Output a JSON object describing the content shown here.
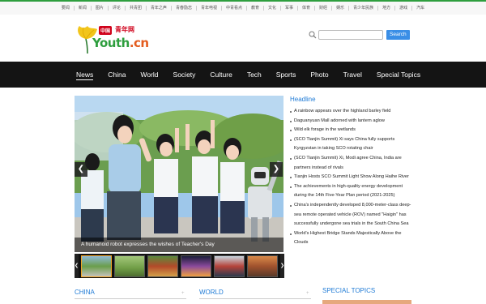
{
  "topbar": {
    "links": [
      "要闻",
      "新闻",
      "图片",
      "评论",
      "共青团",
      "青年之声",
      "青春励志",
      "青年电视",
      "中青看点",
      "教育",
      "文化",
      "军事",
      "体育",
      "财经",
      "娱乐",
      "青少年民族",
      "地方",
      "游戏",
      "汽车"
    ]
  },
  "logo": {
    "badge": "中国",
    "cn_text": "青年网",
    "en_prefix": "Y",
    "en_main": "outh",
    "en_suffix": ".cn"
  },
  "search": {
    "placeholder": "",
    "button_label": "Search"
  },
  "nav": {
    "items": [
      {
        "label": "News",
        "active": true
      },
      {
        "label": "China",
        "active": false
      },
      {
        "label": "World",
        "active": false
      },
      {
        "label": "Society",
        "active": false
      },
      {
        "label": "Culture",
        "active": false
      },
      {
        "label": "Tech",
        "active": false
      },
      {
        "label": "Sports",
        "active": false
      },
      {
        "label": "Photo",
        "active": false
      },
      {
        "label": "Travel",
        "active": false
      },
      {
        "label": "Special Topics",
        "active": false
      }
    ]
  },
  "hero": {
    "caption": "A humanoid robot expresses the wishes of Teacher's Day",
    "prev_glyph": "❮",
    "next_glyph": "❯"
  },
  "thumbs": {
    "prev_glyph": "❮",
    "next_glyph": "❯",
    "count": 6
  },
  "headline": {
    "title": "Headline",
    "items": [
      "A rainbow appears over the highland barley field",
      "Daguanyuan Mall adorned with lantern aglow",
      "Wild elk forage in the wetlands",
      "(SCO Tianjin Summit) Xi says China fully supports Kyrgyzstan in taking SCO rotating chair",
      "(SCO Tianjin Summit) Xi, Modi agree China, India are partners instead of rivals",
      "Tianjin Hosts SCO Summit Light Show Along Haihe River",
      "The achievements in high-quality energy development during the 14th Five-Year Plan period (2021-2025)",
      "China's independently developed 8,000-meter-class deep-sea remote operated vehicle (ROV) named \"Haigin\" has successfully undergone sea trials in the South China Sea",
      "World's Highest Bridge Stands Majestically Above the Clouds"
    ]
  },
  "sections": {
    "china": "CHINA",
    "world": "WORLD",
    "special": "SPECIAL TOPICS",
    "more_glyph": "+"
  },
  "colors": {
    "accent_blue": "#1f7bd6",
    "nav_bg": "#141414",
    "brand_green": "#2e9e3e",
    "brand_red": "#d0021b"
  }
}
